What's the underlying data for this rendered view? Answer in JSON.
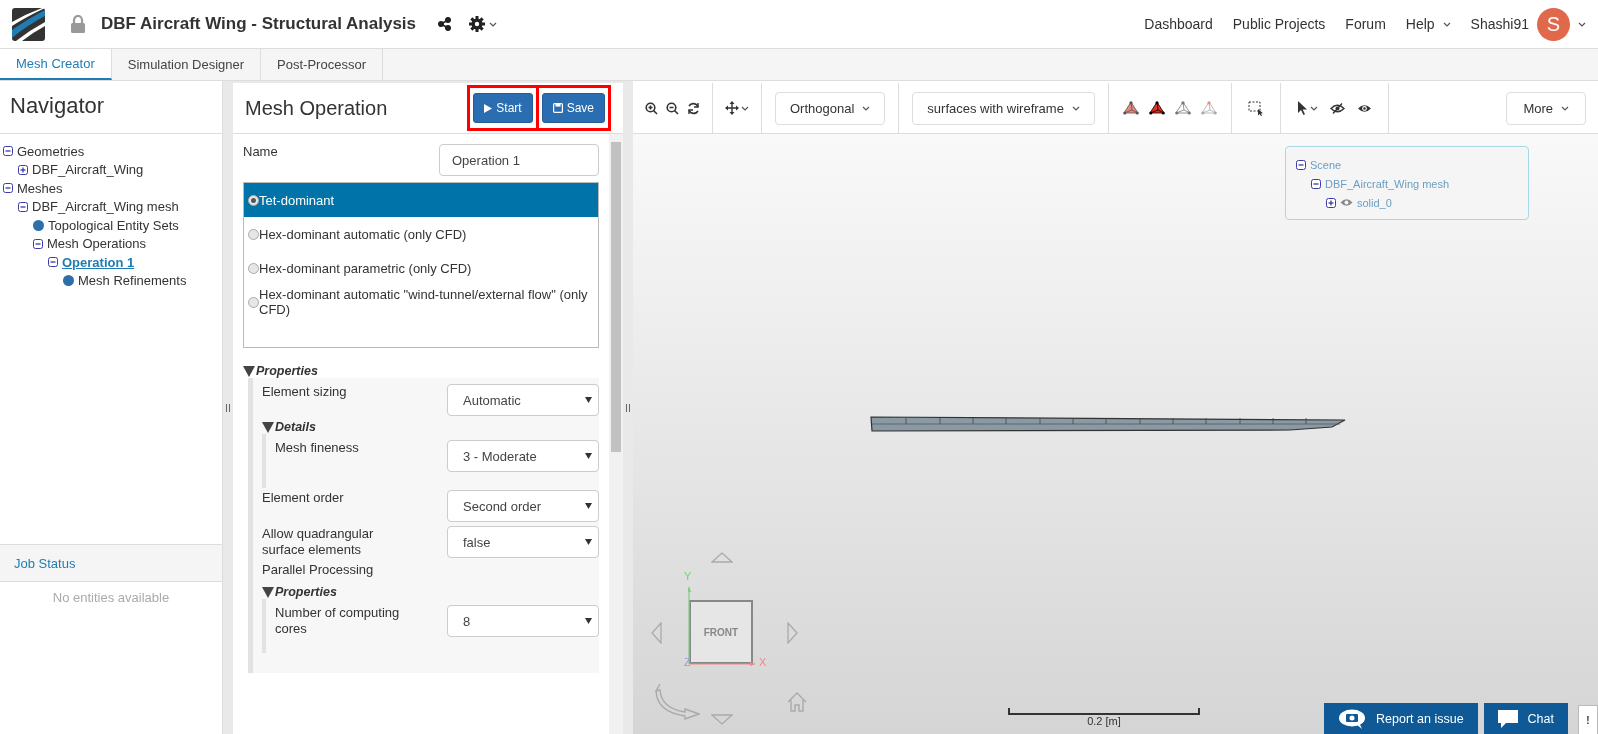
{
  "header": {
    "title": "DBF Aircraft Wing - Structural Analysis",
    "nav": [
      {
        "label": "Dashboard",
        "dropdown": false
      },
      {
        "label": "Public Projects",
        "dropdown": false
      },
      {
        "label": "Forum",
        "dropdown": false
      },
      {
        "label": "Help",
        "dropdown": true
      }
    ],
    "user": {
      "name": "Shashi91",
      "initial": "S"
    }
  },
  "tabs": [
    {
      "label": "Mesh Creator",
      "selected": true
    },
    {
      "label": "Simulation Designer",
      "selected": false
    },
    {
      "label": "Post-Processor",
      "selected": false
    }
  ],
  "navigator": {
    "title": "Navigator",
    "tree": [
      {
        "label": "Geometries",
        "kind": "folder",
        "expanded": true,
        "selected": false,
        "children": [
          {
            "label": "DBF_Aircraft_Wing",
            "kind": "folder",
            "expanded": false,
            "selected": false
          }
        ]
      },
      {
        "label": "Meshes",
        "kind": "folder",
        "expanded": true,
        "selected": false,
        "children": [
          {
            "label": "DBF_Aircraft_Wing mesh",
            "kind": "folder",
            "expanded": true,
            "selected": false,
            "children": [
              {
                "label": "Topological Entity Sets",
                "kind": "leaf",
                "selected": false
              },
              {
                "label": "Mesh Operations",
                "kind": "folder",
                "expanded": true,
                "selected": false,
                "children": [
                  {
                    "label": "Operation 1",
                    "kind": "folder",
                    "expanded": true,
                    "selected": true,
                    "children": [
                      {
                        "label": "Mesh Refinements",
                        "kind": "leaf",
                        "selected": false
                      }
                    ]
                  }
                ]
              }
            ]
          }
        ]
      }
    ]
  },
  "job_status": {
    "title": "Job Status",
    "empty_text": "No entities available"
  },
  "mesh_operation": {
    "title": "Mesh Operation",
    "buttons": [
      {
        "label": "Start",
        "kind": "start",
        "highlighted": true
      },
      {
        "label": "Save",
        "kind": "save",
        "highlighted": true
      }
    ],
    "name_field": {
      "label": "Name",
      "value": "Operation 1"
    },
    "algorithms": [
      {
        "label": "Tet-dominant",
        "selected": true
      },
      {
        "label": "Hex-dominant automatic (only CFD)",
        "selected": false
      },
      {
        "label": "Hex-dominant parametric (only CFD)",
        "selected": false
      },
      {
        "label": "Hex-dominant automatic \"wind-tunnel/external flow\" (only CFD)",
        "selected": false
      }
    ],
    "properties": {
      "title": "Properties",
      "expanded": true,
      "items": [
        {
          "kind": "select",
          "label": "Element sizing",
          "value": "Automatic"
        },
        {
          "kind": "group",
          "title": "Details",
          "expanded": true,
          "items": [
            {
              "kind": "select",
              "label": "Mesh fineness",
              "value": "3 - Moderate"
            }
          ]
        },
        {
          "kind": "select",
          "label": "Element order",
          "value": "Second order"
        },
        {
          "kind": "select",
          "label": "Allow quadrangular surface elements",
          "value": "false"
        },
        {
          "kind": "text",
          "label": "Parallel Processing"
        },
        {
          "kind": "group",
          "title": "Properties",
          "expanded": true,
          "items": [
            {
              "kind": "select",
              "label": "Number of computing cores",
              "value": "8"
            }
          ]
        }
      ]
    }
  },
  "viewer": {
    "projection": "Orthogonal",
    "render_mode": "surfaces with wireframe",
    "more": "More",
    "scene_tree": [
      {
        "label": "Scene",
        "kind": "folder",
        "expanded": true,
        "children": [
          {
            "label": "DBF_Aircraft_Wing mesh",
            "kind": "folder",
            "expanded": true,
            "children": [
              {
                "label": "solid_0",
                "kind": "solid",
                "expanded": false
              }
            ]
          }
        ]
      }
    ],
    "view_cube": {
      "face": "FRONT",
      "x_axis": "X",
      "y_axis": "Y",
      "z_axis": "Z"
    },
    "scale": "0.2 [m]"
  },
  "footer_buttons": [
    {
      "label": "Report an issue",
      "kind": "report"
    },
    {
      "label": "Chat",
      "kind": "chat"
    }
  ],
  "side_tab": "!"
}
